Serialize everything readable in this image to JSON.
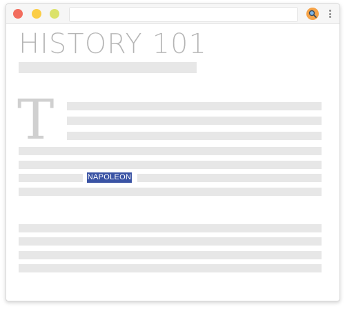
{
  "browser": {
    "url_value": "",
    "search_icon": "search-icon",
    "menu_icon": "kebab-menu-icon"
  },
  "page": {
    "title": "HISTORY 101",
    "drop_cap": "T",
    "highlighted_word": "NAPOLEON"
  },
  "colors": {
    "close": "#f26d5e",
    "minimize": "#fbcd45",
    "maximize": "#dbe26a",
    "search_button": "#f6a348",
    "highlight": "#3a53a4",
    "placeholder_bar": "#e7e7e7"
  }
}
